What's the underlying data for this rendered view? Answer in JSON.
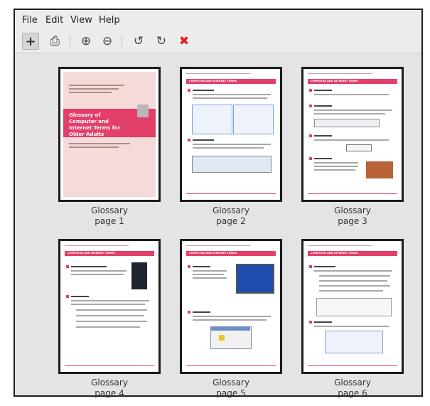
{
  "menu": [
    "File",
    "Edit",
    "View",
    "Help"
  ],
  "toolbar": {
    "add_glyph": "+",
    "export_glyph": "⎙",
    "zoom_in_glyph": "⊕",
    "zoom_out_glyph": "⊖",
    "rotate_left_glyph": "↺",
    "rotate_right_glyph": "↻",
    "delete_glyph": "✖"
  },
  "pages": [
    {
      "doc": "Glossary",
      "label": "page 1"
    },
    {
      "doc": "Glossary",
      "label": "page 2"
    },
    {
      "doc": "Glossary",
      "label": "page 3"
    },
    {
      "doc": "Glossary",
      "label": "page 4"
    },
    {
      "doc": "Glossary",
      "label": "page 5"
    },
    {
      "doc": "Glossary",
      "label": "page 6"
    }
  ],
  "cover": {
    "title": "Glossary of Computer and Internet Terms for Older Adults"
  },
  "section_header": "COMPUTER AND INTERNET TERMS",
  "colors": {
    "accent": "#e23f6a",
    "delete": "#e01d24",
    "cover_bg": "#f4dad8"
  }
}
